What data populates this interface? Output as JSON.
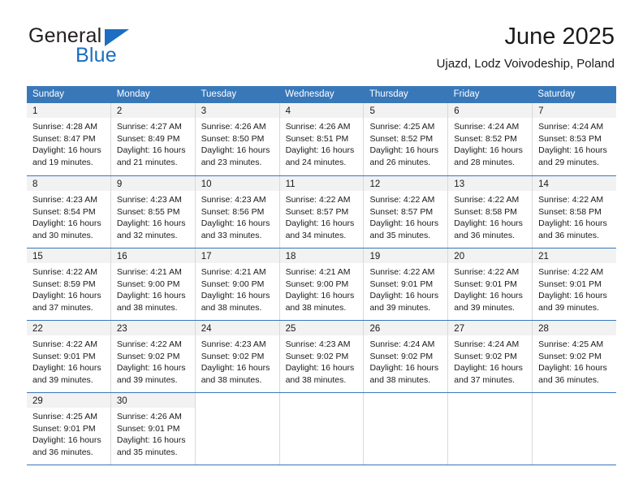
{
  "brand": {
    "name_top": "General",
    "name_bottom": "Blue",
    "triangle_icon": "blue-triangle-icon",
    "accent_color": "#1b6ec2"
  },
  "header": {
    "title": "June 2025",
    "subtitle": "Ujazd, Lodz Voivodeship, Poland"
  },
  "calendar": {
    "header_bg": "#3878b9",
    "daynum_bg": "#f2f2f2",
    "weekdays": [
      "Sunday",
      "Monday",
      "Tuesday",
      "Wednesday",
      "Thursday",
      "Friday",
      "Saturday"
    ],
    "weeks": [
      [
        {
          "day": "1",
          "lines": [
            "Sunrise: 4:28 AM",
            "Sunset: 8:47 PM",
            "Daylight: 16 hours",
            "and 19 minutes."
          ]
        },
        {
          "day": "2",
          "lines": [
            "Sunrise: 4:27 AM",
            "Sunset: 8:49 PM",
            "Daylight: 16 hours",
            "and 21 minutes."
          ]
        },
        {
          "day": "3",
          "lines": [
            "Sunrise: 4:26 AM",
            "Sunset: 8:50 PM",
            "Daylight: 16 hours",
            "and 23 minutes."
          ]
        },
        {
          "day": "4",
          "lines": [
            "Sunrise: 4:26 AM",
            "Sunset: 8:51 PM",
            "Daylight: 16 hours",
            "and 24 minutes."
          ]
        },
        {
          "day": "5",
          "lines": [
            "Sunrise: 4:25 AM",
            "Sunset: 8:52 PM",
            "Daylight: 16 hours",
            "and 26 minutes."
          ]
        },
        {
          "day": "6",
          "lines": [
            "Sunrise: 4:24 AM",
            "Sunset: 8:52 PM",
            "Daylight: 16 hours",
            "and 28 minutes."
          ]
        },
        {
          "day": "7",
          "lines": [
            "Sunrise: 4:24 AM",
            "Sunset: 8:53 PM",
            "Daylight: 16 hours",
            "and 29 minutes."
          ]
        }
      ],
      [
        {
          "day": "8",
          "lines": [
            "Sunrise: 4:23 AM",
            "Sunset: 8:54 PM",
            "Daylight: 16 hours",
            "and 30 minutes."
          ]
        },
        {
          "day": "9",
          "lines": [
            "Sunrise: 4:23 AM",
            "Sunset: 8:55 PM",
            "Daylight: 16 hours",
            "and 32 minutes."
          ]
        },
        {
          "day": "10",
          "lines": [
            "Sunrise: 4:23 AM",
            "Sunset: 8:56 PM",
            "Daylight: 16 hours",
            "and 33 minutes."
          ]
        },
        {
          "day": "11",
          "lines": [
            "Sunrise: 4:22 AM",
            "Sunset: 8:57 PM",
            "Daylight: 16 hours",
            "and 34 minutes."
          ]
        },
        {
          "day": "12",
          "lines": [
            "Sunrise: 4:22 AM",
            "Sunset: 8:57 PM",
            "Daylight: 16 hours",
            "and 35 minutes."
          ]
        },
        {
          "day": "13",
          "lines": [
            "Sunrise: 4:22 AM",
            "Sunset: 8:58 PM",
            "Daylight: 16 hours",
            "and 36 minutes."
          ]
        },
        {
          "day": "14",
          "lines": [
            "Sunrise: 4:22 AM",
            "Sunset: 8:58 PM",
            "Daylight: 16 hours",
            "and 36 minutes."
          ]
        }
      ],
      [
        {
          "day": "15",
          "lines": [
            "Sunrise: 4:22 AM",
            "Sunset: 8:59 PM",
            "Daylight: 16 hours",
            "and 37 minutes."
          ]
        },
        {
          "day": "16",
          "lines": [
            "Sunrise: 4:21 AM",
            "Sunset: 9:00 PM",
            "Daylight: 16 hours",
            "and 38 minutes."
          ]
        },
        {
          "day": "17",
          "lines": [
            "Sunrise: 4:21 AM",
            "Sunset: 9:00 PM",
            "Daylight: 16 hours",
            "and 38 minutes."
          ]
        },
        {
          "day": "18",
          "lines": [
            "Sunrise: 4:21 AM",
            "Sunset: 9:00 PM",
            "Daylight: 16 hours",
            "and 38 minutes."
          ]
        },
        {
          "day": "19",
          "lines": [
            "Sunrise: 4:22 AM",
            "Sunset: 9:01 PM",
            "Daylight: 16 hours",
            "and 39 minutes."
          ]
        },
        {
          "day": "20",
          "lines": [
            "Sunrise: 4:22 AM",
            "Sunset: 9:01 PM",
            "Daylight: 16 hours",
            "and 39 minutes."
          ]
        },
        {
          "day": "21",
          "lines": [
            "Sunrise: 4:22 AM",
            "Sunset: 9:01 PM",
            "Daylight: 16 hours",
            "and 39 minutes."
          ]
        }
      ],
      [
        {
          "day": "22",
          "lines": [
            "Sunrise: 4:22 AM",
            "Sunset: 9:01 PM",
            "Daylight: 16 hours",
            "and 39 minutes."
          ]
        },
        {
          "day": "23",
          "lines": [
            "Sunrise: 4:22 AM",
            "Sunset: 9:02 PM",
            "Daylight: 16 hours",
            "and 39 minutes."
          ]
        },
        {
          "day": "24",
          "lines": [
            "Sunrise: 4:23 AM",
            "Sunset: 9:02 PM",
            "Daylight: 16 hours",
            "and 38 minutes."
          ]
        },
        {
          "day": "25",
          "lines": [
            "Sunrise: 4:23 AM",
            "Sunset: 9:02 PM",
            "Daylight: 16 hours",
            "and 38 minutes."
          ]
        },
        {
          "day": "26",
          "lines": [
            "Sunrise: 4:24 AM",
            "Sunset: 9:02 PM",
            "Daylight: 16 hours",
            "and 38 minutes."
          ]
        },
        {
          "day": "27",
          "lines": [
            "Sunrise: 4:24 AM",
            "Sunset: 9:02 PM",
            "Daylight: 16 hours",
            "and 37 minutes."
          ]
        },
        {
          "day": "28",
          "lines": [
            "Sunrise: 4:25 AM",
            "Sunset: 9:02 PM",
            "Daylight: 16 hours",
            "and 36 minutes."
          ]
        }
      ],
      [
        {
          "day": "29",
          "lines": [
            "Sunrise: 4:25 AM",
            "Sunset: 9:01 PM",
            "Daylight: 16 hours",
            "and 36 minutes."
          ]
        },
        {
          "day": "30",
          "lines": [
            "Sunrise: 4:26 AM",
            "Sunset: 9:01 PM",
            "Daylight: 16 hours",
            "and 35 minutes."
          ]
        },
        {
          "day": "",
          "lines": []
        },
        {
          "day": "",
          "lines": []
        },
        {
          "day": "",
          "lines": []
        },
        {
          "day": "",
          "lines": []
        },
        {
          "day": "",
          "lines": []
        }
      ]
    ]
  }
}
